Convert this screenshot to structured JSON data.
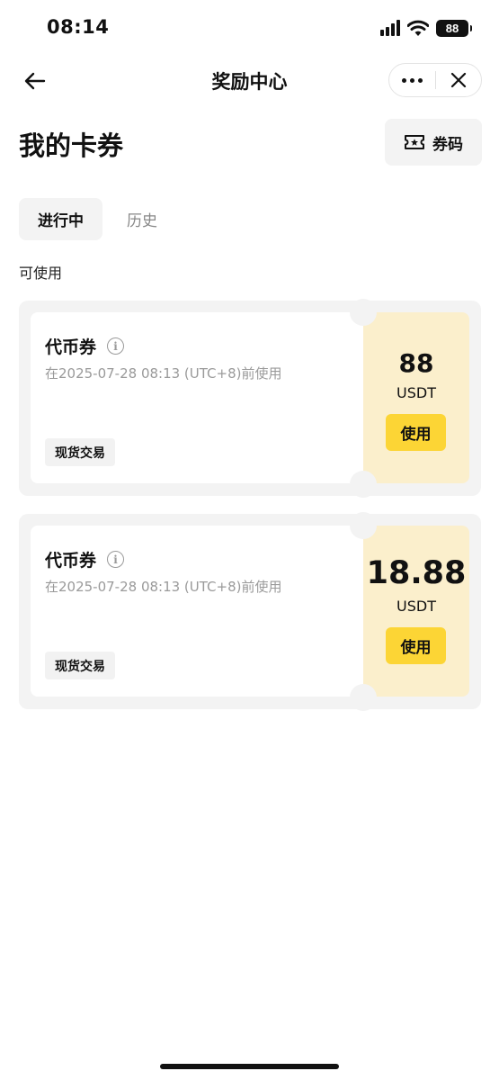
{
  "status_bar": {
    "time": "08:14",
    "battery": "88"
  },
  "header": {
    "title": "奖励中心"
  },
  "page": {
    "title": "我的卡券",
    "code_button_label": "券码"
  },
  "tabs": [
    {
      "label": "进行中",
      "active": true
    },
    {
      "label": "历史",
      "active": false
    }
  ],
  "section_label": "可使用",
  "coupons": [
    {
      "name": "代币券",
      "expiry": "在2025-07-28 08:13 (UTC+8)前使用",
      "tag": "现货交易",
      "amount": "88",
      "unit": "USDT",
      "use_label": "使用"
    },
    {
      "name": "代币券",
      "expiry": "在2025-07-28 08:13 (UTC+8)前使用",
      "tag": "现货交易",
      "amount": "18.88",
      "unit": "USDT",
      "use_label": "使用"
    }
  ],
  "colors": {
    "accent": "#fcd535",
    "coupon_stub": "#fbefcc",
    "card_background": "#f3f3f3"
  },
  "icons": [
    "back-arrow-icon",
    "more-icon",
    "close-icon",
    "ticket-icon",
    "info-icon",
    "signal-icon",
    "wifi-icon",
    "battery-icon"
  ]
}
